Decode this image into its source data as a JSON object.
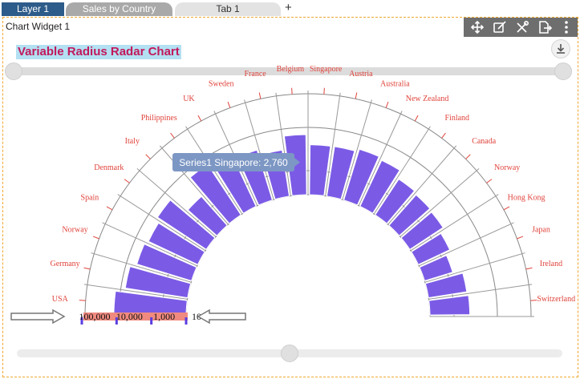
{
  "tabs": [
    {
      "label": "Layer 1"
    },
    {
      "label": "Sales by Country"
    },
    {
      "label": "Tab 1"
    }
  ],
  "add_tab_label": "+",
  "widget": {
    "title": "Chart Widget 1",
    "toolbar_icons": [
      "move-icon",
      "edit-icon",
      "tools-icon",
      "export-icon",
      "more-icon"
    ]
  },
  "chart_data": {
    "type": "bar",
    "subtype": "variable-radius-radar (polar half-circle)",
    "title": "Variable Radius Radar Chart",
    "categories": [
      "USA",
      "Germany",
      "Norway",
      "Spain",
      "Denmark",
      "Italy",
      "Philippines",
      "UK",
      "Sweden",
      "France",
      "Belgium",
      "Singapore",
      "Austria",
      "Australia",
      "New Zealand",
      "Finland",
      "Canada",
      "Norway",
      "Hong Kong",
      "Japan",
      "Ireland",
      "Switzerland"
    ],
    "series": [
      {
        "name": "Series1",
        "values": [
          12000,
          6500,
          4400,
          3700,
          4800,
          1300,
          5500,
          2600,
          3200,
          2200,
          5400,
          2760,
          2800,
          3400,
          2900,
          1700,
          1500,
          1400,
          1000,
          700,
          1300,
          1400
        ]
      }
    ],
    "scale": "log",
    "radial_ticks": [
      "100,000",
      "10,000",
      "1,000",
      "100"
    ],
    "tooltip": "Series1 Singapore: 2,760",
    "colors": {
      "bar": "#7b5be6",
      "label": "#e0443c",
      "axis_band": "#f08a80",
      "tooltip_bg": "#7d97c4"
    }
  }
}
